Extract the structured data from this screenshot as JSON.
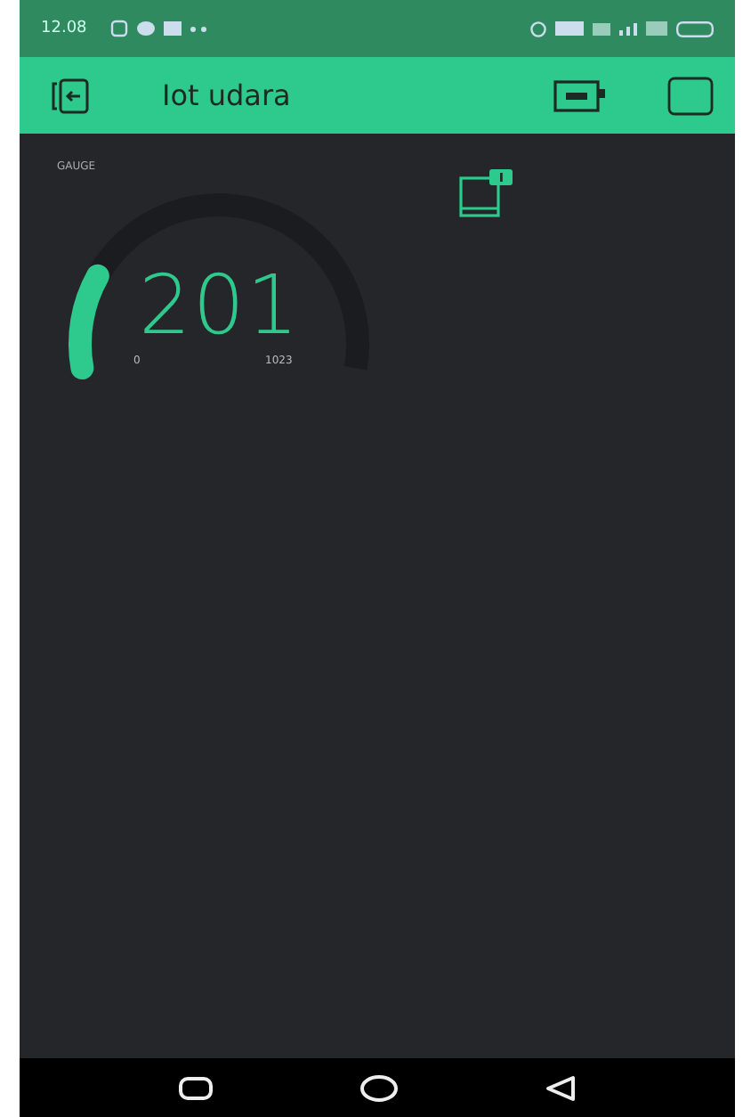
{
  "status_bar": {
    "time": "12.08"
  },
  "header": {
    "title": "Iot udara"
  },
  "gauge": {
    "label": "GAUGE",
    "value": "201",
    "min": "0",
    "max": "1023",
    "level": 0.196
  }
}
